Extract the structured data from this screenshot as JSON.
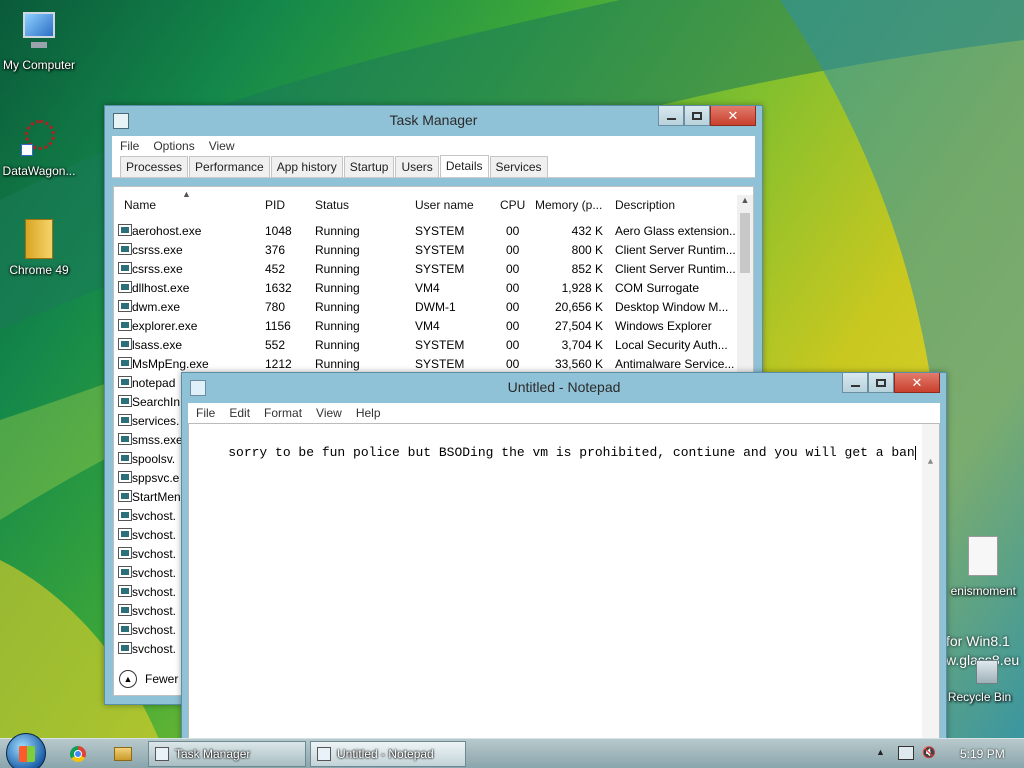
{
  "desktop": {
    "icons": [
      {
        "label": "My Computer"
      },
      {
        "label": "DataWagon..."
      },
      {
        "label": "Chrome 49"
      },
      {
        "label": "enismoment"
      },
      {
        "label": "Recycle Bin"
      }
    ],
    "watermark_line1": "for Win8.1",
    "watermark_line2": "w.glass8.eu"
  },
  "task_manager": {
    "title": "Task Manager",
    "menu": [
      "File",
      "Options",
      "View"
    ],
    "tabs": [
      "Processes",
      "Performance",
      "App history",
      "Startup",
      "Users",
      "Details",
      "Services"
    ],
    "active_tab": "Details",
    "columns": [
      "Name",
      "PID",
      "Status",
      "User name",
      "CPU",
      "Memory (p...",
      "Description"
    ],
    "rows": [
      [
        "aerohost.exe",
        "1048",
        "Running",
        "SYSTEM",
        "00",
        "432 K",
        "Aero Glass extension..."
      ],
      [
        "csrss.exe",
        "376",
        "Running",
        "SYSTEM",
        "00",
        "800 K",
        "Client Server Runtim..."
      ],
      [
        "csrss.exe",
        "452",
        "Running",
        "SYSTEM",
        "00",
        "852 K",
        "Client Server Runtim..."
      ],
      [
        "dllhost.exe",
        "1632",
        "Running",
        "VM4",
        "00",
        "1,928 K",
        "COM Surrogate"
      ],
      [
        "dwm.exe",
        "780",
        "Running",
        "DWM-1",
        "00",
        "20,656 K",
        "Desktop Window M..."
      ],
      [
        "explorer.exe",
        "1156",
        "Running",
        "VM4",
        "00",
        "27,504 K",
        "Windows Explorer"
      ],
      [
        "lsass.exe",
        "552",
        "Running",
        "SYSTEM",
        "00",
        "3,704 K",
        "Local Security Auth..."
      ],
      [
        "MsMpEng.exe",
        "1212",
        "Running",
        "SYSTEM",
        "00",
        "33,560 K",
        "Antimalware Service..."
      ],
      [
        "notepad",
        "",
        "",
        "",
        "",
        "",
        ""
      ],
      [
        "SearchIn",
        "",
        "",
        "",
        "",
        "",
        ""
      ],
      [
        "services.",
        "",
        "",
        "",
        "",
        "",
        ""
      ],
      [
        "smss.exe",
        "",
        "",
        "",
        "",
        "",
        ""
      ],
      [
        "spoolsv.",
        "",
        "",
        "",
        "",
        "",
        ""
      ],
      [
        "sppsvc.e",
        "",
        "",
        "",
        "",
        "",
        ""
      ],
      [
        "StartMen",
        "",
        "",
        "",
        "",
        "",
        ""
      ],
      [
        "svchost.",
        "",
        "",
        "",
        "",
        "",
        ""
      ],
      [
        "svchost.",
        "",
        "",
        "",
        "",
        "",
        ""
      ],
      [
        "svchost.",
        "",
        "",
        "",
        "",
        "",
        ""
      ],
      [
        "svchost.",
        "",
        "",
        "",
        "",
        "",
        ""
      ],
      [
        "svchost.",
        "",
        "",
        "",
        "",
        "",
        ""
      ],
      [
        "svchost.",
        "",
        "",
        "",
        "",
        "",
        ""
      ],
      [
        "svchost.",
        "",
        "",
        "",
        "",
        "",
        ""
      ],
      [
        "svchost.",
        "",
        "",
        "",
        "",
        "",
        ""
      ]
    ],
    "fewer_details": "Fewer"
  },
  "notepad": {
    "title": "Untitled - Notepad",
    "menu": [
      "File",
      "Edit",
      "Format",
      "View",
      "Help"
    ],
    "text": "sorry to be fun police but BSODing the vm is prohibited, contiune and you will get a ban"
  },
  "taskbar": {
    "buttons": [
      "Task Manager",
      "Untitled - Notepad"
    ],
    "clock": "5:19 PM"
  }
}
